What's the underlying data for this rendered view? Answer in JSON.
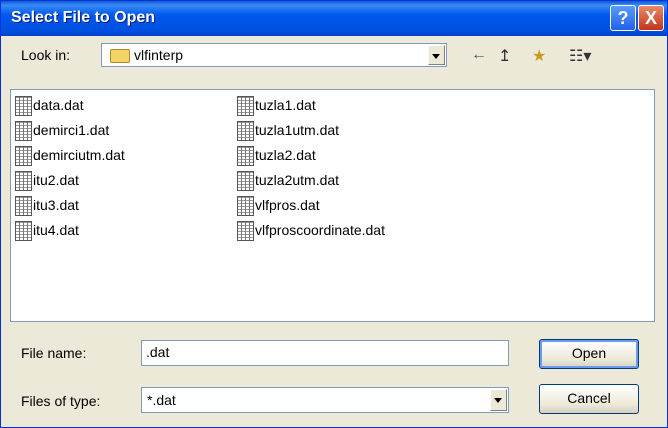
{
  "window": {
    "title": "Select File to Open",
    "help_label": "?",
    "close_label": "X"
  },
  "look_in": {
    "label": "Look in:",
    "value": "vlfinterp"
  },
  "toolbar": {
    "back_icon": "←",
    "up_icon": "↥",
    "new_folder_icon": "★",
    "view_icon": "☷▾"
  },
  "files": {
    "col1": [
      "data.dat",
      "demirci1.dat",
      "demirciutm.dat",
      "itu2.dat",
      "itu3.dat",
      "itu4.dat"
    ],
    "col2": [
      "tuzla1.dat",
      "tuzla1utm.dat",
      "tuzla2.dat",
      "tuzla2utm.dat",
      "vlfpros.dat",
      "vlfproscoordinate.dat"
    ]
  },
  "file_name": {
    "label": "File name:",
    "value": ".dat"
  },
  "file_type": {
    "label": "Files of type:",
    "value": "*.dat"
  },
  "buttons": {
    "open": "Open",
    "cancel": "Cancel"
  }
}
